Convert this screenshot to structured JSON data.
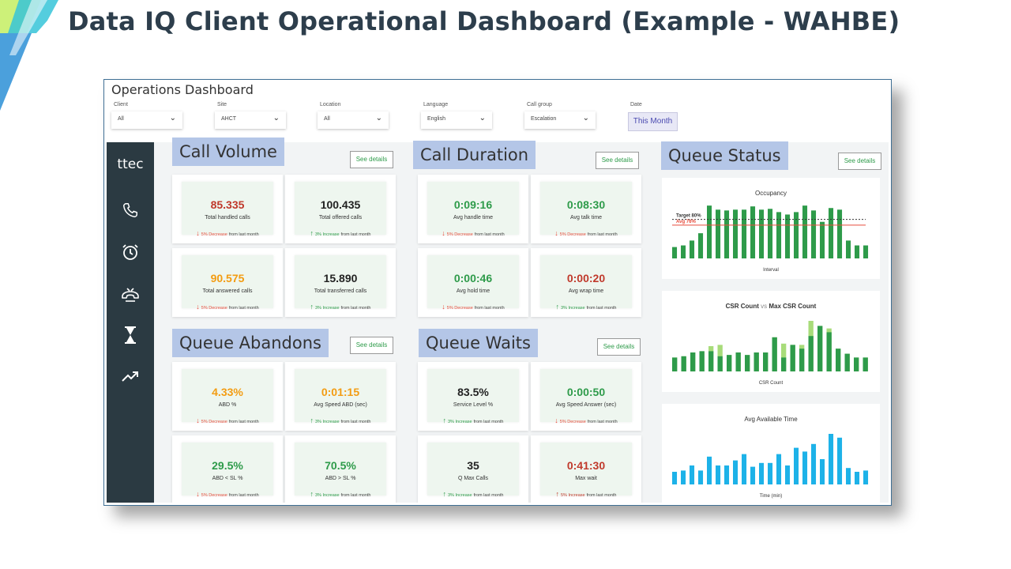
{
  "slide_title": "Data IQ Client Operational Dashboard (Example - WAHBE)",
  "app": {
    "title": "Operations Dashboard",
    "logo": "ttec"
  },
  "filters": [
    {
      "label": "Client",
      "value": "All"
    },
    {
      "label": "Site",
      "value": "AHCT"
    },
    {
      "label": "Location",
      "value": "All"
    },
    {
      "label": "Language",
      "value": "English"
    },
    {
      "label": "Call group",
      "value": "Escalation"
    },
    {
      "label": "Date",
      "value": "This Month"
    }
  ],
  "sidebar_icons": [
    "phone-icon",
    "alarm-clock-icon",
    "hang-up-icon",
    "hourglass-icon",
    "trending-up-icon"
  ],
  "see_details": "See details",
  "sections": {
    "call_volume": {
      "title": "Call Volume",
      "cards": [
        {
          "value": "85.335",
          "name": "Total handled calls",
          "dir": "down",
          "pct": "5% Decrease",
          "suffix": "from last month",
          "color": "#c0392b"
        },
        {
          "value": "100.435",
          "name": "Total offered calls",
          "dir": "up",
          "pct": "3% Increase",
          "suffix": "from last month",
          "color": "#222222"
        },
        {
          "value": "90.575",
          "name": "Total answered calls",
          "dir": "down",
          "pct": "5% Decrease",
          "suffix": "from last month",
          "color": "#f39c12"
        },
        {
          "value": "15.890",
          "name": "Total transferred calls",
          "dir": "up",
          "pct": "3% Increase",
          "suffix": "from last month",
          "color": "#222222"
        }
      ]
    },
    "call_duration": {
      "title": "Call Duration",
      "cards": [
        {
          "value": "0:09:16",
          "name": "Avg handle time",
          "dir": "down",
          "pct": "5% Decrease",
          "suffix": "from last month",
          "color": "#2e9b4a"
        },
        {
          "value": "0:08:30",
          "name": "Avg talk time",
          "dir": "down",
          "pct": "5% Decrease",
          "suffix": "from last month",
          "color": "#2e9b4a"
        },
        {
          "value": "0:00:46",
          "name": "Avg hold time",
          "dir": "down",
          "pct": "5% Decrease",
          "suffix": "from last month",
          "color": "#2e9b4a"
        },
        {
          "value": "0:00:20",
          "name": "Avg wrap time",
          "dir": "up",
          "pct": "3% Increase",
          "suffix": "from last month",
          "color": "#c0392b"
        }
      ]
    },
    "queue_abandons": {
      "title": "Queue Abandons",
      "cards": [
        {
          "value": "4.33%",
          "name": "ABD %",
          "dir": "down",
          "pct": "5% Decrease",
          "suffix": "from last month",
          "color": "#f39c12"
        },
        {
          "value": "0:01:15",
          "name": "Avg Speed ABD (sec)",
          "dir": "up",
          "pct": "3% Increase",
          "suffix": "from last month",
          "color": "#f39c12"
        },
        {
          "value": "29.5%",
          "name": "ABD < SL %",
          "dir": "down",
          "pct": "5% Decrease",
          "suffix": "from last month",
          "color": "#2e9b4a"
        },
        {
          "value": "70.5%",
          "name": "ABD > SL %",
          "dir": "up",
          "pct": "3% Increase",
          "suffix": "from last month",
          "color": "#2e9b4a"
        }
      ]
    },
    "queue_waits": {
      "title": "Queue Waits",
      "cards": [
        {
          "value": "83.5%",
          "name": "Service Level %",
          "dir": "up",
          "pct": "3% Increase",
          "suffix": "from last month",
          "color": "#222222"
        },
        {
          "value": "0:00:50",
          "name": "Avg Speed Answer (sec)",
          "dir": "down",
          "pct": "5% Decrease",
          "suffix": "from last month",
          "color": "#2e9b4a"
        },
        {
          "value": "35",
          "name": "Q Max Calls",
          "dir": "up",
          "pct": "3% Increase",
          "suffix": "from last month",
          "color": "#222222"
        },
        {
          "value": "0:41:30",
          "name": "Max wait",
          "dir": "up-red",
          "pct": "5% Increase",
          "suffix": "from last month",
          "color": "#c0392b"
        }
      ]
    },
    "queue_status": {
      "title": "Queue Status"
    }
  },
  "colors": {
    "up": "#2e9b4a",
    "down": "#e74c3c",
    "up-red": "#c0392b"
  },
  "chart_data": [
    {
      "type": "bar",
      "title": "Occupancy",
      "xlabel": "Interval",
      "ylabel": "",
      "series": [
        {
          "name": "",
          "values": [
            14,
            16,
            22,
            31,
            65,
            60,
            59,
            60,
            60,
            64,
            60,
            61,
            57,
            54,
            57,
            65,
            59,
            45,
            62,
            60,
            22,
            16,
            16
          ]
        }
      ],
      "reference_lines": [
        {
          "label": "Target 80%",
          "value": 48,
          "style": "dashed",
          "color": "#333333"
        },
        {
          "label": "Avg 76%",
          "value": 41,
          "style": "solid",
          "color": "#e74c3c"
        }
      ],
      "ylim": [
        0,
        70
      ],
      "color": "#2e9b4a"
    },
    {
      "type": "bar",
      "title": "CSR Count",
      "title_vs": "vs",
      "title_tail": "Max CSR Count",
      "xlabel": "CSR Count",
      "ylabel": "",
      "series": [
        {
          "name": "",
          "values": [
            11,
            12,
            15,
            16,
            16,
            12,
            13,
            15,
            13,
            15,
            15,
            27,
            11,
            21,
            18,
            28,
            36,
            31,
            18,
            14,
            11,
            11
          ]
        },
        {
          "name": "",
          "values": [
            11,
            12,
            15,
            16,
            20,
            21,
            13,
            15,
            13,
            15,
            15,
            27,
            22,
            21,
            21,
            40,
            36,
            34,
            18,
            14,
            11,
            11
          ]
        }
      ],
      "ylim": [
        0,
        45
      ],
      "colors": [
        "#2e9b4a",
        "#a8dc7a"
      ]
    },
    {
      "type": "bar",
      "title": "Avg Available Time",
      "xlabel": "Time (min)",
      "ylabel": "",
      "series": [
        {
          "name": "",
          "values": [
            10,
            11,
            15,
            11,
            22,
            15,
            15,
            19,
            24,
            14,
            17,
            17,
            24,
            15,
            29,
            26,
            32,
            20,
            40,
            37,
            13,
            10,
            11
          ]
        }
      ],
      "ylim": [
        0,
        45
      ],
      "color": "#1db2e8"
    }
  ]
}
